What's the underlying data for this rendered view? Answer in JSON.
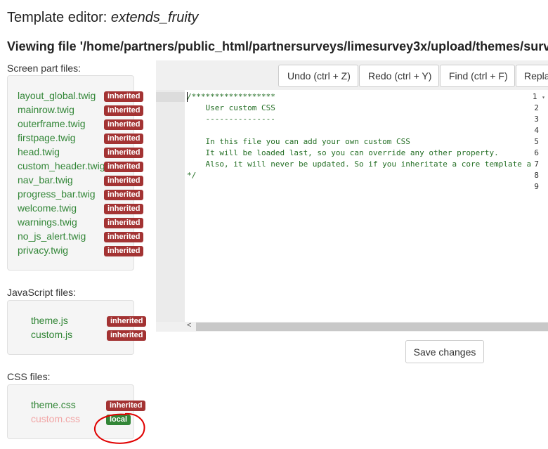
{
  "header": {
    "title_prefix": "Template editor:",
    "title_theme": "extends_fruity",
    "viewing_file": "Viewing file '/home/partners/public_html/partnersurveys/limesurvey3x/upload/themes/survey/e"
  },
  "screen_part_files": {
    "label": "Screen part files:",
    "items": [
      {
        "name": "layout_global.twig",
        "badge": "inherited"
      },
      {
        "name": "mainrow.twig",
        "badge": "inherited"
      },
      {
        "name": "outerframe.twig",
        "badge": "inherited"
      },
      {
        "name": "firstpage.twig",
        "badge": "inherited"
      },
      {
        "name": "head.twig",
        "badge": "inherited"
      },
      {
        "name": "custom_header.twig",
        "badge": "inherited"
      },
      {
        "name": "nav_bar.twig",
        "badge": "inherited"
      },
      {
        "name": "progress_bar.twig",
        "badge": "inherited"
      },
      {
        "name": "welcome.twig",
        "badge": "inherited"
      },
      {
        "name": "warnings.twig",
        "badge": "inherited"
      },
      {
        "name": "no_js_alert.twig",
        "badge": "inherited"
      },
      {
        "name": "privacy.twig",
        "badge": "inherited"
      }
    ]
  },
  "js_files": {
    "label": "JavaScript files:",
    "items": [
      {
        "name": "theme.js",
        "badge": "inherited"
      },
      {
        "name": "custom.js",
        "badge": "inherited"
      }
    ]
  },
  "css_files": {
    "label": "CSS files:",
    "items": [
      {
        "name": "theme.css",
        "badge": "inherited"
      },
      {
        "name": "custom.css",
        "badge": "local"
      }
    ]
  },
  "toolbar": {
    "undo": "Undo (ctrl + Z)",
    "redo": "Redo (ctrl + Y)",
    "find": "Find (ctrl + F)",
    "replace": "Repla"
  },
  "editor": {
    "line_numbers": [
      "1",
      "2",
      "3",
      "4",
      "5",
      "6",
      "7",
      "8",
      "9"
    ],
    "lines": [
      "/******************",
      "    User custom CSS",
      "    ---------------",
      "",
      "    In this file you can add your own custom CSS",
      "    It will be loaded last, so you can override any other property.",
      "    Also, it will never be updated. So if you inheritate a core template a",
      "*/",
      ""
    ]
  },
  "save_label": "Save changes",
  "colors": {
    "file_link": "#328637",
    "badge_inherited": "#a33333",
    "badge_local": "#328637",
    "annotation": "#e00000"
  }
}
